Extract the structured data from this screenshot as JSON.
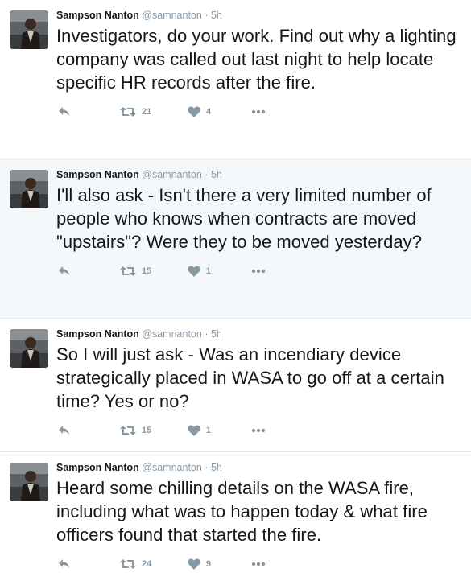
{
  "tweets": [
    {
      "name": "Sampson Nanton",
      "handle": "@samnanton",
      "dot": "·",
      "time": "5h",
      "text": "Investigators, do your work. Find out why a lighting company was called out last night to help locate specific HR records after the fire.",
      "retweets": "21",
      "likes": "4",
      "highlight": false
    },
    {
      "name": "Sampson Nanton",
      "handle": "@samnanton",
      "dot": "·",
      "time": "5h",
      "text": "I'll also ask - Isn't there a very limited number of people who knows when contracts are moved \"upstairs\"? Were they to be moved yesterday?",
      "retweets": "15",
      "likes": "1",
      "highlight": true
    },
    {
      "name": "Sampson Nanton",
      "handle": "@samnanton",
      "dot": "·",
      "time": "5h",
      "text": "So I will just ask - Was an incendiary device strategically placed in WASA to go off at a certain time? Yes or no?",
      "retweets": "15",
      "likes": "1",
      "highlight": false
    },
    {
      "name": "Sampson Nanton",
      "handle": "@samnanton",
      "dot": "·",
      "time": "5h",
      "text": "Heard some chilling details on the WASA fire, including what was to happen today & what fire officers found that started the fire.",
      "retweets": "24",
      "likes": "9",
      "highlight": false
    }
  ],
  "colors": {
    "text": "#14171a",
    "muted": "#8899a6",
    "highlight_bg": "#f5f8fa",
    "border": "#e1e8ed"
  },
  "icons": {
    "reply": "reply-icon",
    "retweet": "retweet-icon",
    "like": "heart-icon",
    "more": "more-icon"
  }
}
